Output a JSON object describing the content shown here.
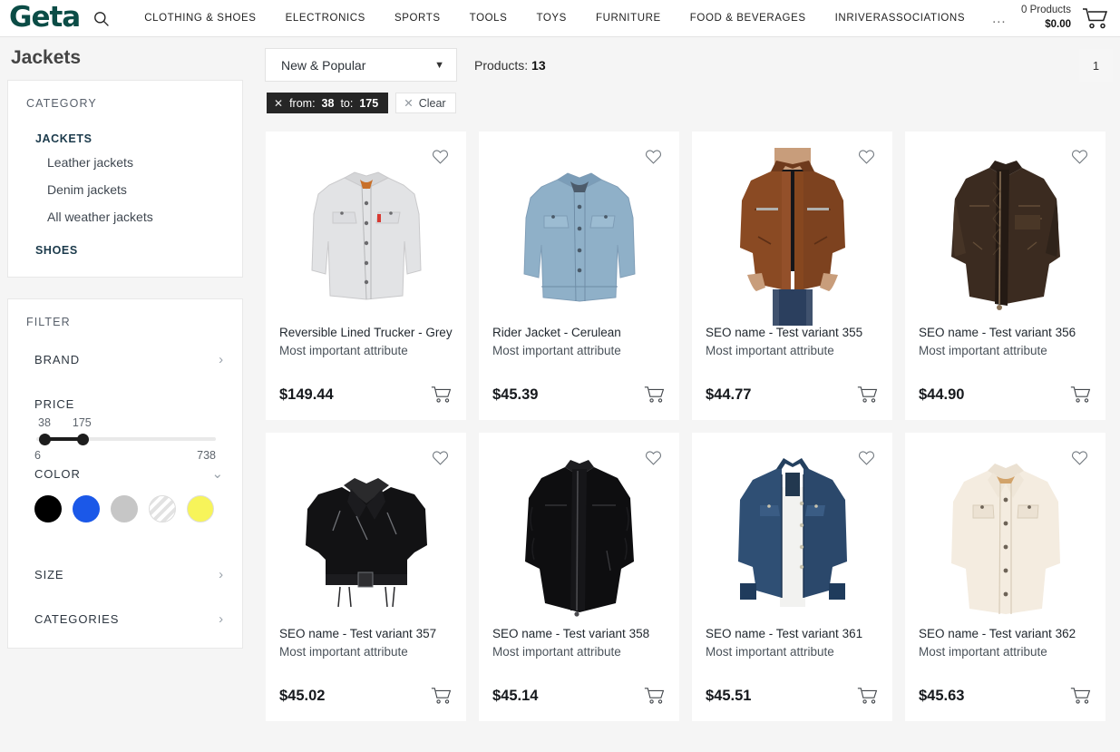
{
  "header": {
    "logo": "Geta",
    "search_icon": "search-icon",
    "nav": [
      {
        "label": "CLOTHING & SHOES"
      },
      {
        "label": "ELECTRONICS"
      },
      {
        "label": "SPORTS"
      },
      {
        "label": "TOOLS"
      },
      {
        "label": "TOYS"
      },
      {
        "label": "FURNITURE"
      },
      {
        "label": "FOOD & BEVERAGES"
      },
      {
        "label": "INRIVERASSOCIATIONS"
      }
    ],
    "more": "...",
    "cart": {
      "products": "0 Products",
      "amount": "$0.00",
      "icon": "shopping-cart-icon"
    }
  },
  "page_title": "Jackets",
  "sidebar": {
    "category": {
      "heading": "CATEGORY",
      "items": [
        {
          "label": "JACKETS",
          "level": "root",
          "active": true
        },
        {
          "label": "Leather jackets",
          "level": "sub"
        },
        {
          "label": "Denim jackets",
          "level": "sub"
        },
        {
          "label": "All weather jackets",
          "level": "sub"
        },
        {
          "label": "SHOES",
          "level": "root",
          "active": false
        }
      ]
    },
    "filter": {
      "heading": "FILTER",
      "brand": "BRAND",
      "price": {
        "label": "PRICE",
        "selected_min": "38",
        "selected_max": "175",
        "range_min": "6",
        "range_max": "738"
      },
      "color": {
        "label": "COLOR",
        "swatches": [
          {
            "name": "black",
            "hex": "#000000"
          },
          {
            "name": "blue",
            "hex": "#1b58e8"
          },
          {
            "name": "grey",
            "hex": "#c6c6c6"
          },
          {
            "name": "multi",
            "hex": "#f0f0f0"
          },
          {
            "name": "yellow",
            "hex": "#f7f45a"
          }
        ]
      },
      "size": "SIZE",
      "categories": "CATEGORIES"
    }
  },
  "toolbar": {
    "sort_value": "New & Popular",
    "products_label": "Products:",
    "products_count": "13",
    "page_number": "1",
    "chips": [
      {
        "type": "filter",
        "prefix_from": "from:",
        "from": "38",
        "prefix_to": "to:",
        "to": "175"
      },
      {
        "type": "clear",
        "label": "Clear"
      }
    ]
  },
  "products": [
    {
      "title": "Reversible Lined Trucker - Grey",
      "attribute": "Most important attribute",
      "price": "$149.44",
      "image": "light-grey-denim-trucker-jacket"
    },
    {
      "title": "Rider Jacket - Cerulean",
      "attribute": "Most important attribute",
      "price": "$45.39",
      "image": "light-blue-denim-jacket"
    },
    {
      "title": "SEO name - Test variant 355",
      "attribute": "Most important attribute",
      "price": "$44.77",
      "image": "brown-leather-jacket-on-model"
    },
    {
      "title": "SEO name - Test variant 356",
      "attribute": "Most important attribute",
      "price": "$44.90",
      "image": "distressed-dark-brown-leather-jacket"
    },
    {
      "title": "SEO name - Test variant 357",
      "attribute": "Most important attribute",
      "price": "$45.02",
      "image": "black-cropped-biker-jacket"
    },
    {
      "title": "SEO name - Test variant 358",
      "attribute": "Most important attribute",
      "price": "$45.14",
      "image": "black-zip-front-jacket"
    },
    {
      "title": "SEO name - Test variant 361",
      "attribute": "Most important attribute",
      "price": "$45.51",
      "image": "blue-denim-jacket-white-top"
    },
    {
      "title": "SEO name - Test variant 362",
      "attribute": "Most important attribute",
      "price": "$45.63",
      "image": "cream-overshirt"
    }
  ]
}
